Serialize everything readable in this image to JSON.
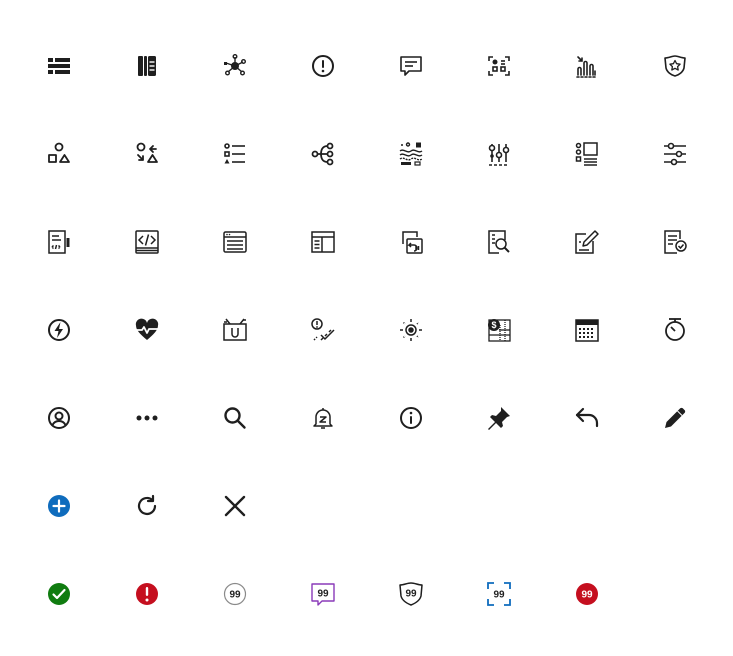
{
  "icons": [
    {
      "name": "list-detailed-icon"
    },
    {
      "name": "book-library-icon"
    },
    {
      "name": "network-graph-icon"
    },
    {
      "name": "circle-exclamation-icon"
    },
    {
      "name": "comment-text-icon"
    },
    {
      "name": "shapes-scan-icon"
    },
    {
      "name": "chart-bars-arrow-icon"
    },
    {
      "name": "shield-star-icon"
    },
    {
      "name": "shapes-icon"
    },
    {
      "name": "shapes-cycle-icon"
    },
    {
      "name": "list-shapes-icon"
    },
    {
      "name": "branch-icon"
    },
    {
      "name": "layers-filter-icon"
    },
    {
      "name": "slider-settings-icon"
    },
    {
      "name": "list-preview-icon"
    },
    {
      "name": "sliders-icon"
    },
    {
      "name": "document-code-side-icon"
    },
    {
      "name": "code-window-icon"
    },
    {
      "name": "list-panel-icon"
    },
    {
      "name": "layout-columns-icon"
    },
    {
      "name": "window-copy-icon"
    },
    {
      "name": "document-search-icon"
    },
    {
      "name": "note-edit-icon"
    },
    {
      "name": "document-check-icon"
    },
    {
      "name": "lightning-circle-icon"
    },
    {
      "name": "heart-pulse-icon"
    },
    {
      "name": "tv-unicode-icon"
    },
    {
      "name": "alert-check-icon"
    },
    {
      "name": "target-sun-icon"
    },
    {
      "name": "calendar-dollar-icon"
    },
    {
      "name": "calendar-grid-icon"
    },
    {
      "name": "timer-icon"
    },
    {
      "name": "user-circle-icon"
    },
    {
      "name": "more-horizontal-icon"
    },
    {
      "name": "search-icon"
    },
    {
      "name": "bell-snooze-icon"
    },
    {
      "name": "info-circle-icon"
    },
    {
      "name": "pin-icon"
    },
    {
      "name": "reply-arrow-icon"
    },
    {
      "name": "pencil-icon"
    },
    {
      "name": "add-circle-icon"
    },
    {
      "name": "refresh-icon"
    },
    {
      "name": "close-icon"
    }
  ],
  "badges": {
    "count_label": "99",
    "colors": {
      "success": "#107c10",
      "error": "#c50f1f",
      "neutral": "#616161",
      "purple": "#8a3ab9",
      "blue": "#0f6cbd",
      "accent_blue": "#0f6cbd",
      "danger_fill": "#c50f1f"
    }
  }
}
